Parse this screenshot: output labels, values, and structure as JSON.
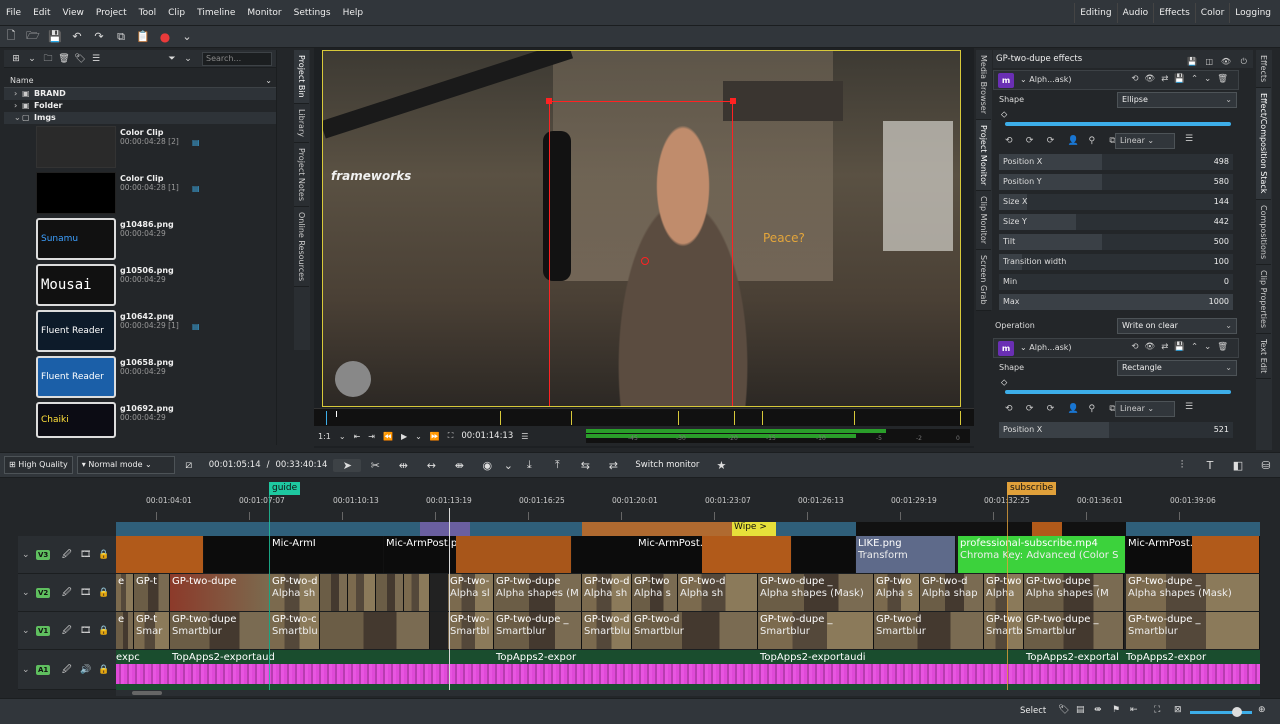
{
  "menu": [
    "File",
    "Edit",
    "View",
    "Project",
    "Tool",
    "Clip",
    "Timeline",
    "Monitor",
    "Settings",
    "Help"
  ],
  "layouts": [
    "Editing",
    "Audio",
    "Effects",
    "Color",
    "Logging"
  ],
  "bin": {
    "search_placeholder": "Search...",
    "column_header": "Name",
    "folders": [
      "BRAND",
      "Folder",
      "Imgs"
    ],
    "clips": [
      {
        "name": "Color Clip",
        "duration": "00:00:04:28 [2]",
        "thumb": ""
      },
      {
        "name": "Color Clip",
        "duration": "00:00:04:28 [1]",
        "thumb": ""
      },
      {
        "name": "g10486.png",
        "duration": "00:00:04:29",
        "thumb": "Sunamu"
      },
      {
        "name": "g10506.png",
        "duration": "00:00:04:29",
        "thumb": "Mousai"
      },
      {
        "name": "g10642.png",
        "duration": "00:00:04:29 [1]",
        "thumb": "Fluent Reader"
      },
      {
        "name": "g10658.png",
        "duration": "00:00:04:29",
        "thumb": "Fluent Reader"
      },
      {
        "name": "g10692.png",
        "duration": "00:00:04:29",
        "thumb": "Chaiki"
      }
    ]
  },
  "left_tabs": [
    "Project Bin",
    "Library",
    "Project Notes",
    "Online Resources"
  ],
  "mid_tabs": [
    "Media Browser",
    "Project Monitor",
    "Clip Monitor",
    "Screen Grab"
  ],
  "right_tabs": [
    "Effects",
    "Effect/Composition Stack",
    "Compositions",
    "Clip Properties",
    "Text Edit"
  ],
  "monitor": {
    "brand_text": "frameworks",
    "overlay_text": "Peace?",
    "zoom": "1:1",
    "timecode": "00:01:14:13",
    "vu_labels": [
      "-45",
      "-30",
      "-20",
      "-15",
      "-10",
      "-5",
      "-2",
      "0"
    ]
  },
  "effects": {
    "title": "GP-two-dupe effects",
    "effect1": {
      "name": "Alph...ask)",
      "shape_label": "Shape",
      "shape_value": "Ellipse",
      "interp": "Linear",
      "params": [
        {
          "label": "Position X",
          "value": "498",
          "frac": 0.44
        },
        {
          "label": "Position Y",
          "value": "580",
          "frac": 0.44
        },
        {
          "label": "Size X",
          "value": "144",
          "frac": 0.12
        },
        {
          "label": "Size Y",
          "value": "442",
          "frac": 0.33
        },
        {
          "label": "Tilt",
          "value": "500",
          "frac": 0.44
        },
        {
          "label": "Transition width",
          "value": "100",
          "frac": 0.1
        },
        {
          "label": "Min",
          "value": "0",
          "frac": 0
        },
        {
          "label": "Max",
          "value": "1000",
          "frac": 1
        }
      ],
      "op_label": "Operation",
      "op_value": "Write on clear"
    },
    "effect2": {
      "name": "Alph...ask)",
      "shape_label": "Shape",
      "shape_value": "Rectangle",
      "interp": "Linear",
      "param_label": "Position X",
      "param_value": "521"
    }
  },
  "timeline_toolbar": {
    "quality": "High Quality",
    "mode": "Normal mode",
    "position": "00:01:05:14",
    "duration": "00:33:40:14",
    "switch_monitor": "Switch monitor"
  },
  "ruler": {
    "labels": [
      "00:01:04:01",
      "00:01:07:07",
      "00:01:10:13",
      "00:01:13:19",
      "00:01:16:25",
      "00:01:20:01",
      "00:01:23:07",
      "00:01:26:13",
      "00:01:29:19",
      "00:01:32:25",
      "00:01:36:01",
      "00:01:39:06"
    ],
    "guides": [
      {
        "label": "guide",
        "color": "#1ec8a0"
      },
      {
        "label": "subscribe",
        "color": "#e0a03a"
      }
    ]
  },
  "tracks": {
    "names": [
      "V3",
      "V2",
      "V1",
      "A1"
    ],
    "zone_labels": [
      "Wipe >"
    ],
    "v3": [
      "Mic-ArmI",
      "Mic-ArmPost.png",
      "Mic-ArmPost.png",
      "LIKE.png",
      "Transform",
      "professional-subscribe.mp4",
      "Chroma Key: Advanced (Color S",
      "Mic-ArmPost.png"
    ],
    "v2_top": [
      "GP-two-dupe",
      "GP-two-dupe",
      "GP-two-d",
      "GP-two-dupe _",
      "GP-two-dupe _",
      "GP-two-dupe _",
      "GP-two-dupe _"
    ],
    "v2_sub": [
      "Alpha shapes (Mask)",
      "Alpha shapes (M",
      "Alpha shapes (Mask)",
      "Alpha shapes (M"
    ],
    "v1_top": [
      "GP-two-dupe",
      "GP-two-dupe _",
      "GP-two-dupe _",
      "GP-two-dupe _",
      "GP-two-dupe _"
    ],
    "v1_sub": [
      "Smartblur",
      "Smartblur"
    ],
    "a1": [
      "TopApps2-exportaud",
      "TopApps2-expor",
      "TopApps2-exportaudi",
      "TopApps2-exportal",
      "TopApps2-expor"
    ]
  },
  "status": {
    "select": "Select"
  },
  "colors": {
    "accent": "#3daee9",
    "track_label": "#5fbf5f",
    "clip_orange": "#b15a1a",
    "clip_green": "#3cd23c",
    "waveform": "#e04ad8"
  }
}
